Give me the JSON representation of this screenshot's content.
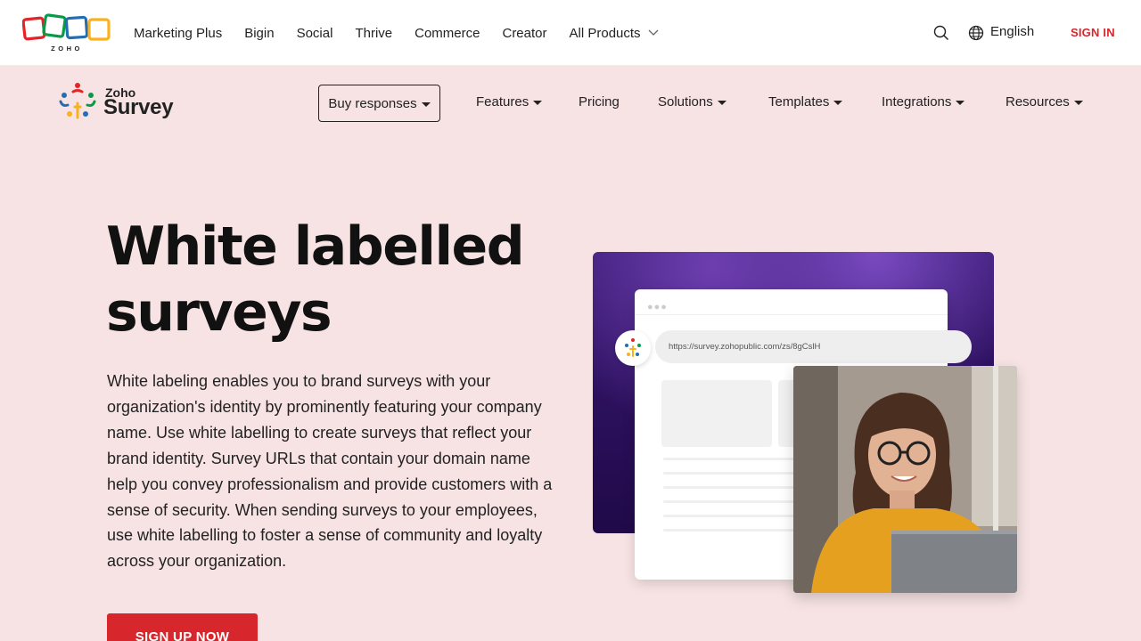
{
  "topnav": {
    "logo_text": "ZOHO",
    "links": [
      "Marketing Plus",
      "Bigin",
      "Social",
      "Thrive",
      "Commerce",
      "Creator"
    ],
    "all_products": "All Products",
    "language": "English",
    "sign_in": "SIGN IN"
  },
  "product_nav": {
    "brand_top": "Zoho",
    "brand_main": "Survey",
    "buy_responses": "Buy responses",
    "items": [
      "Features",
      "Pricing",
      "Solutions",
      "Templates",
      "Integrations",
      "Resources"
    ]
  },
  "hero": {
    "title_line1": "White labelled",
    "title_line2": "surveys",
    "description": "White labeling enables you to brand surveys with your organization's identity by prominently featuring your company name. Use white labelling to create surveys that reflect your brand identity. Survey URLs that contain your domain name help you convey professionalism and provide customers with a sense of security. When sending surveys to your employees, use white labelling to foster a sense of community and loyalty across your organization.",
    "cta": "SIGN UP NOW"
  },
  "illustration": {
    "url": "https://survey.zohopublic.com/zs/8gCslH"
  },
  "colors": {
    "page_bg": "#f7e3e3",
    "accent_red": "#d7262c",
    "panel_purple": "#2a0f5a"
  }
}
